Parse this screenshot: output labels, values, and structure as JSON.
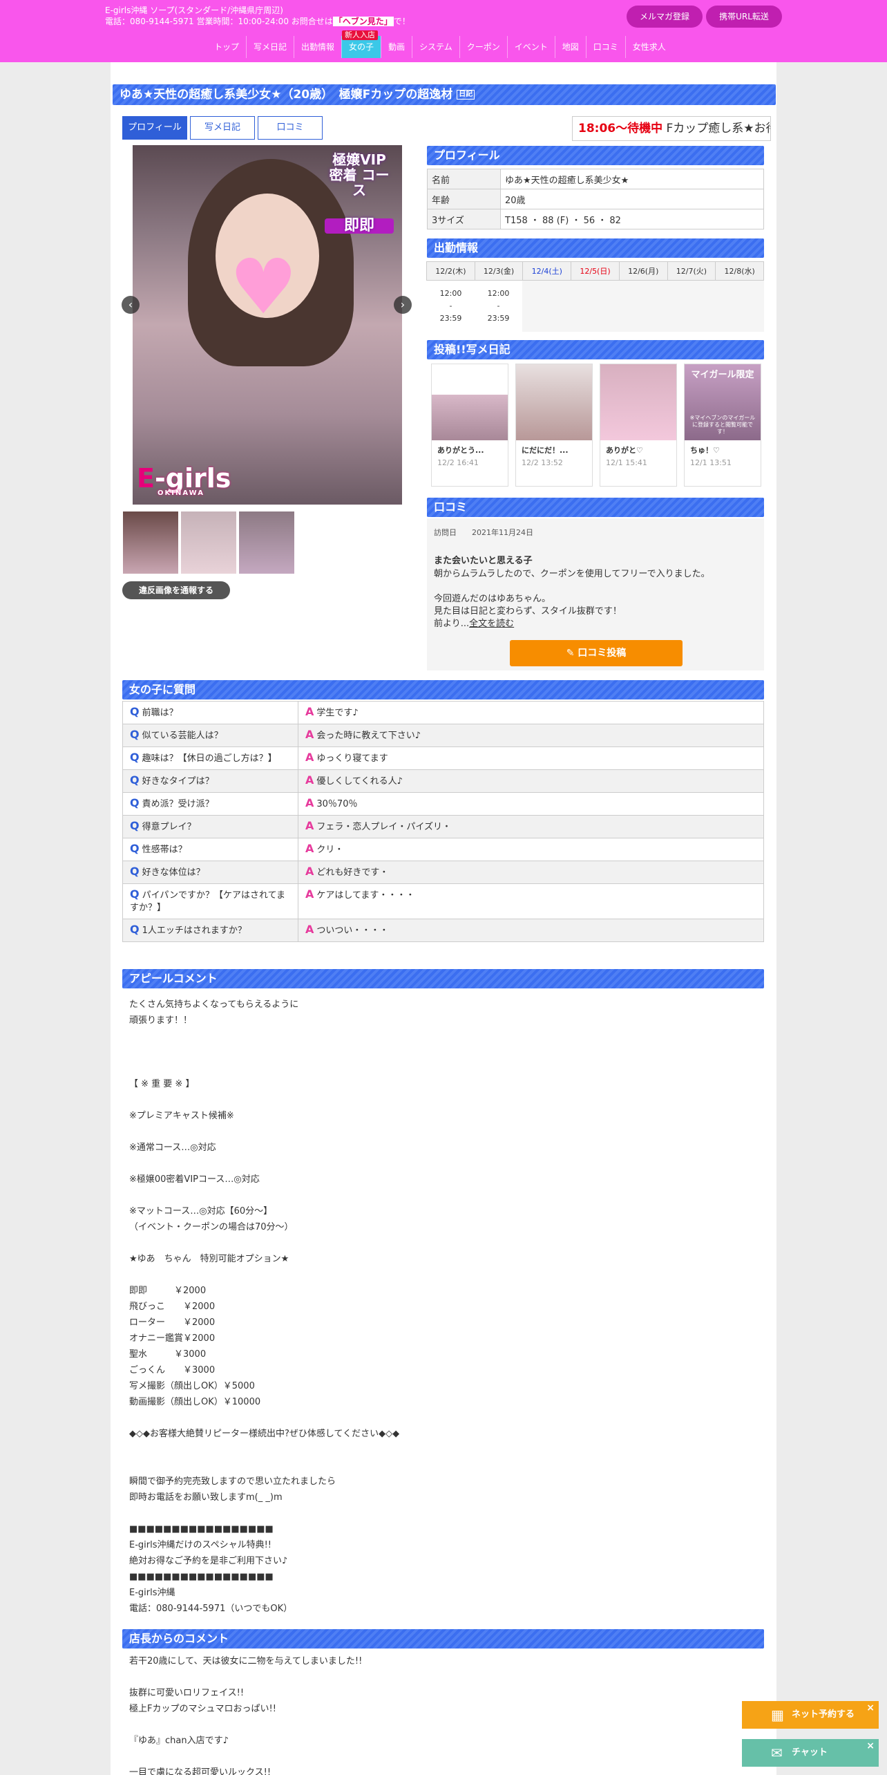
{
  "header": {
    "shop_line": "E-girls沖縄 ソープ(スタンダード/沖縄県庁周辺)",
    "tel_prefix": "電話：080-9144-5971 営業時間：10:00-24:00 お問合せは",
    "tel_highlight": "「ヘブン見た」",
    "tel_suffix": "で！",
    "mailmag_label": "メルマガ登録",
    "mobile_label": "携帯URL転送",
    "accent": "#f956ec"
  },
  "nav": {
    "items": [
      "トップ",
      "写メ日記",
      "出勤情報",
      "女の子",
      "動画",
      "システム",
      "クーポン",
      "イベント",
      "地図",
      "口コミ",
      "女性求人"
    ],
    "active": "女の子",
    "new_badge": "新人入店"
  },
  "title": {
    "text": "ゆあ★天性の超癒し系美少女★（20歳）　極嬢Fカップの超逸材",
    "badge": "日記"
  },
  "tabs": [
    "プロフィール",
    "写メ日記",
    "口コミ"
  ],
  "status": {
    "time": "18:06～待機中",
    "ticker": "Fカップ癒し系★お待ち"
  },
  "photo": {
    "vip_line1": "極嬢VIP",
    "vip_line2": "密着",
    "vip_line3": "コース",
    "sokusoku": "即即",
    "brand": "E-girls",
    "brand_e": "E",
    "brand_rest": "-girls",
    "brand_sub": "OKINAWA"
  },
  "report_label": "違反画像を通報する",
  "profile": {
    "heading": "プロフィール",
    "rows": [
      {
        "k": "名前",
        "v": "ゆあ★天性の超癒し系美少女★"
      },
      {
        "k": "年齢",
        "v": "20歳"
      },
      {
        "k": "3サイズ",
        "v": "T158 ・ 88 (F) ・ 56 ・ 82"
      }
    ]
  },
  "schedule": {
    "heading": "出勤情報",
    "days": [
      "12/2(木)",
      "12/3(金)",
      "12/4(土)",
      "12/5(日)",
      "12/6(月)",
      "12/7(火)",
      "12/8(水)"
    ],
    "shifts": [
      {
        "start": "12:00",
        "sep": "-",
        "end": "23:59"
      },
      {
        "start": "12:00",
        "sep": "-",
        "end": "23:59"
      }
    ]
  },
  "diary": {
    "heading": "投稿!!写メ日記",
    "items": [
      {
        "title": "ありがとう...",
        "date": "12/2 16:41"
      },
      {
        "title": "にだにだ！...",
        "date": "12/2 13:52"
      },
      {
        "title": "ありがと♡",
        "date": "12/1 15:41"
      },
      {
        "title": "ちゅ！♡",
        "date": "12/1 13:51"
      }
    ],
    "locked_head": "マイガール限定",
    "locked_note": "※マイヘブンのマイガールに登録すると閲覧可能です！"
  },
  "review": {
    "heading": "口コミ",
    "visit_label": "訪問日",
    "visit_date": "2021年11月24日",
    "title": "また会いたいと思える子",
    "body": "朝からムラムラしたので、クーポンを使用してフリーで入りました。\n\n今回遊んだのはゆあちゃん。\n見た目は日記と変わらず、スタイル抜群です！\n前より...",
    "more": "全文を読む",
    "post_label": "口コミ投稿"
  },
  "qa": {
    "heading": "女の子に質問",
    "rows": [
      {
        "q": "前職は？",
        "a": "学生です♪"
      },
      {
        "q": "似ている芸能人は？",
        "a": "会った時に教えて下さい♪"
      },
      {
        "q": "趣味は？【休日の過ごし方は？】",
        "a": "ゆっくり寝てます"
      },
      {
        "q": "好きなタイプは？",
        "a": "優しくしてくれる人♪"
      },
      {
        "q": "責め派？受け派？",
        "a": "30％70％"
      },
      {
        "q": "得意プレイ？",
        "a": "フェラ・恋人プレイ・パイズリ・"
      },
      {
        "q": "性感帯は？",
        "a": "クリ・"
      },
      {
        "q": "好きな体位は？",
        "a": "どれも好きです・"
      },
      {
        "q": "パイパンですか？【ケアはされてますか？】",
        "a": "ケアはしてます・・・・"
      },
      {
        "q": "1人エッチはされますか？",
        "a": "ついつい・・・・"
      }
    ]
  },
  "appeal": {
    "heading": "アピールコメント",
    "text": "たくさん気持ちよくなってもらえるように\n頑張ります！！\n\n\n\n【 ※ 重 要 ※ 】\n\n※プレミアキャスト候補※\n\n※通常コース…◎対応\n\n※極嬢00密着VIPコース…◎対応\n\n※マットコース…◎対応【60分～】\n（イベント・クーポンの場合は70分～）\n\n★ゆあ　ちゃん　特別可能オプション★\n\n即即　　　￥2000\n飛びっこ　　￥2000\nローター　　￥2000\nオナニー鑑賞￥2000\n聖水　　　￥3000\nごっくん　　￥3000\n写メ撮影（顔出しOK）￥5000\n動画撮影（顔出しOK）￥10000\n\n◆◇◆お客様大絶賛リピーター様続出中?ぜひ体感してください◆◇◆\n\n\n瞬間で御予約完売致しますので思い立たれましたら\n即時お電話をお願い致しますm(_ _)m\n\n■■■■■■■■■■■■■■■■■\nE-girls沖縄だけのスペシャル特典!!\n絶対お得なご予約を是非ご利用下さい♪\n■■■■■■■■■■■■■■■■■\nE-girls沖縄\n電話：080-9144-5971（いつでもOK）"
  },
  "manager": {
    "heading": "店長からのコメント",
    "text": "若干20歳にして、天は彼女に二物を与えてしまいました!!\n\n抜群に可愛いロリフェイス!!\n極上Fカップのマシュマロおっぱい!!\n\n『ゆあ』chan入店です♪\n\n一目で虜になる超可愛いルックス!!"
  },
  "floating": {
    "reserve_label": "ネット予約する",
    "chat_label": "チャット",
    "close": "×"
  }
}
